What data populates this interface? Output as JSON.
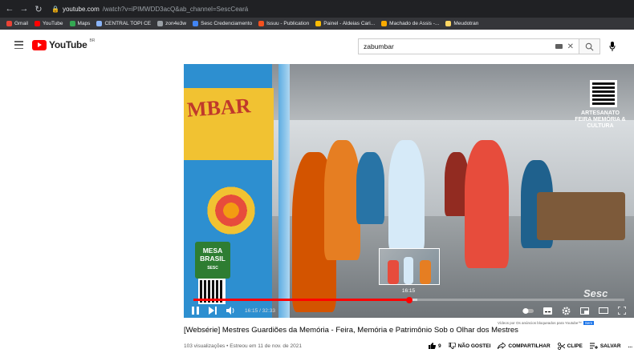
{
  "browser": {
    "url_domain": "youtube.com",
    "url_path": "/watch?v=iPIMWDD3acQ&ab_channel=SescCeará",
    "bookmarks": [
      {
        "label": "Gmail",
        "color": "#ea4335"
      },
      {
        "label": "YouTube",
        "color": "#ff0000"
      },
      {
        "label": "Maps",
        "color": "#34a853"
      },
      {
        "label": "CENTRAL TOPI CE",
        "color": "#8ab4f8"
      },
      {
        "label": "zon4e3w",
        "color": "#9aa0a6"
      },
      {
        "label": "Sesc Credenciamento",
        "color": "#4285f4"
      },
      {
        "label": "Issuu - Publication",
        "color": "#f4511e"
      },
      {
        "label": "Painel - Aldeias Cari...",
        "color": "#fbbc04"
      },
      {
        "label": "Machado de Assis -...",
        "color": "#f9ab00"
      },
      {
        "label": "Meudotran",
        "color": "#fdd663"
      }
    ]
  },
  "header": {
    "logo_text": "YouTube",
    "country_code": "BR",
    "search_value": "zabumbar"
  },
  "video": {
    "overlay_text_tl": "MBAR",
    "overlay_text_tr": "ARTESANATO FEIRA MEMÓRIA & CULTURA",
    "mesa_brasil": "MESA BRASIL",
    "mesa_brasil_sub": "SESC",
    "watermark": "Sesc",
    "preview_time": "16:15",
    "time_display": "16:15 / 32:33",
    "progress": 0.5,
    "buffered": 0.52
  },
  "below": {
    "ad_note": "Vídeos por Os anúncios bloqueados para Youtube™",
    "ad_note_badge": "Sem",
    "title": "[Websérie] Mestres Guardiões da Memória - Feira, Memória e Patrimônio Sob o Olhar dos Mestres",
    "views": "103 visualizações • Estreou em 11 de nov. de 2021",
    "likes": "9",
    "dislike_label": "NÃO GOSTEI",
    "share_label": "COMPARTILHAR",
    "clip_label": "CLIPE",
    "save_label": "SALVAR",
    "more_label": "..."
  }
}
